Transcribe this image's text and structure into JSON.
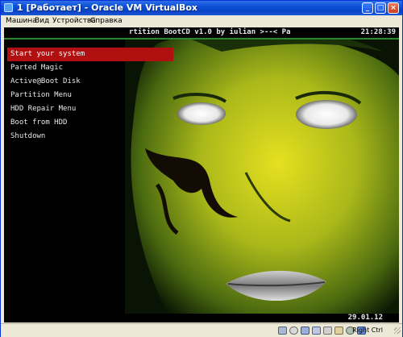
{
  "window": {
    "title": "1 [Работает] - Oracle VM VirtualBox"
  },
  "menubar": {
    "items": [
      "Машина",
      "Вид",
      "Устройства",
      "Справка"
    ]
  },
  "boot": {
    "header_text": "rtition BootCD v1.0 by iulian >--< Pa",
    "clock": "21:28:39",
    "date": "29.01.12",
    "menu": [
      "Start your system",
      "Parted Magic",
      "Active@Boot Disk",
      "Partition Menu",
      "HDD Repair Menu",
      "Boot from HDD",
      "Shutdown"
    ],
    "selected_index": 0
  },
  "statusbar": {
    "host_key_label": "Right Ctrl"
  },
  "colors": {
    "selection": "#b01010",
    "accent_line": "#2a8a2a",
    "titlebar": "#0a4fd6"
  }
}
